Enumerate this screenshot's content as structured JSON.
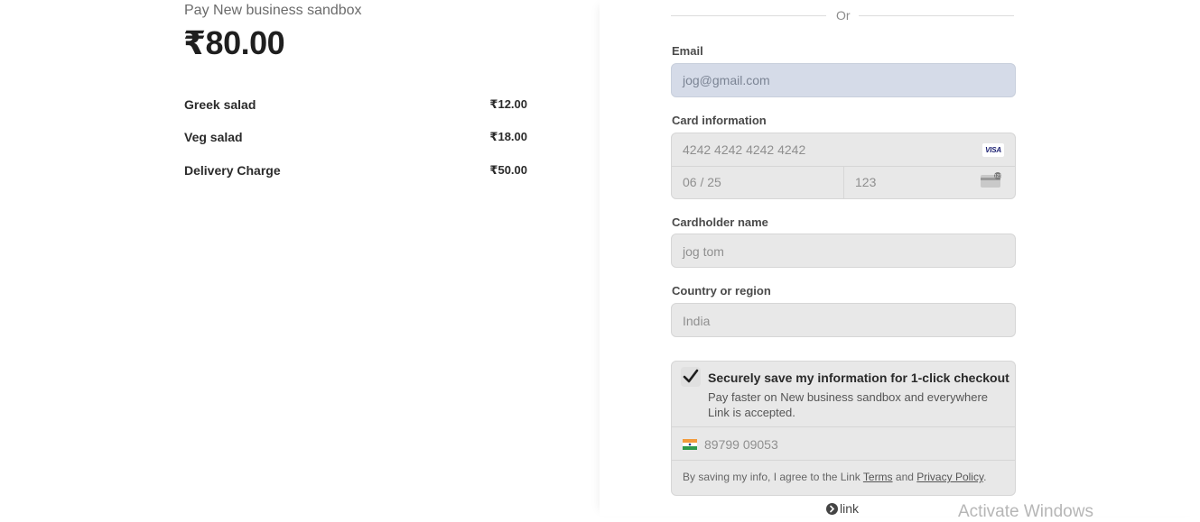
{
  "summary": {
    "merchant": "Pay New business sandbox",
    "total": "₹80.00",
    "items": [
      {
        "name": "Greek salad",
        "amount": "₹12.00"
      },
      {
        "name": "Veg salad",
        "amount": "₹18.00"
      },
      {
        "name": "Delivery Charge",
        "amount": "₹50.00"
      }
    ]
  },
  "payment": {
    "or_text": "Or",
    "email": {
      "label": "Email",
      "value": "jog@gmail.com"
    },
    "card": {
      "label": "Card information",
      "number": "4242 4242 4242 4242",
      "expiry": "06 / 25",
      "cvc": "123",
      "brand_icon": "visa-icon",
      "brand_text": "VISA"
    },
    "cardholder": {
      "label": "Cardholder name",
      "value": "jog tom"
    },
    "country": {
      "label": "Country or region",
      "value": "India"
    },
    "link_save": {
      "checked": true,
      "title": "Securely save my information for 1-click checkout",
      "description": "Pay faster on New business sandbox and everywhere Link is accepted.",
      "phone": "89799 09053",
      "consent_prefix": "By saving my info, I agree to the Link ",
      "terms": "Terms",
      "and": " and ",
      "privacy": "Privacy Policy",
      "suffix": "."
    },
    "link_logo": "link"
  },
  "watermark": "Activate Windows",
  "colors": {
    "email_bg": "#d5dbe8",
    "field_bg": "#e8e8e8",
    "visa_blue": "#1a1f71"
  }
}
